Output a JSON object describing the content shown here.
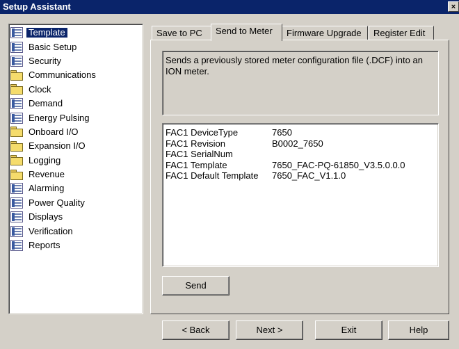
{
  "window": {
    "title": "Setup Assistant",
    "close_glyph": "×"
  },
  "sidebar": {
    "items": [
      {
        "label": "Template",
        "icon": "document-icon",
        "selected": true
      },
      {
        "label": "Basic Setup",
        "icon": "document-icon"
      },
      {
        "label": "Security",
        "icon": "document-icon"
      },
      {
        "label": "Communications",
        "icon": "folder-icon"
      },
      {
        "label": "Clock",
        "icon": "folder-icon"
      },
      {
        "label": "Demand",
        "icon": "document-icon"
      },
      {
        "label": "Energy Pulsing",
        "icon": "document-icon"
      },
      {
        "label": "Onboard I/O",
        "icon": "folder-icon"
      },
      {
        "label": "Expansion I/O",
        "icon": "folder-icon"
      },
      {
        "label": "Logging",
        "icon": "folder-icon"
      },
      {
        "label": "Revenue",
        "icon": "folder-icon"
      },
      {
        "label": "Alarming",
        "icon": "document-icon"
      },
      {
        "label": "Power Quality",
        "icon": "document-icon"
      },
      {
        "label": "Displays",
        "icon": "document-icon"
      },
      {
        "label": "Verification",
        "icon": "document-icon"
      },
      {
        "label": "Reports",
        "icon": "document-icon"
      }
    ]
  },
  "tabs": [
    {
      "label": "Save to PC"
    },
    {
      "label": "Send to Meter",
      "active": true
    },
    {
      "label": "Firmware Upgrade"
    },
    {
      "label": "Register Edit"
    }
  ],
  "description": "Sends a previously stored meter configuration file (.DCF) into an ION meter.",
  "info": [
    {
      "key": "FAC1 DeviceType",
      "value": "7650"
    },
    {
      "key": "FAC1 Revision",
      "value": "B0002_7650"
    },
    {
      "key": "FAC1 SerialNum",
      "value": ""
    },
    {
      "key": "FAC1 Template",
      "value": "7650_FAC-PQ-61850_V3.5.0.0.0"
    },
    {
      "key": "FAC1 Default Template",
      "value": "7650_FAC_V1.1.0"
    }
  ],
  "buttons": {
    "send": "Send",
    "back": "< Back",
    "next": "Next >",
    "exit": "Exit",
    "help": "Help"
  }
}
